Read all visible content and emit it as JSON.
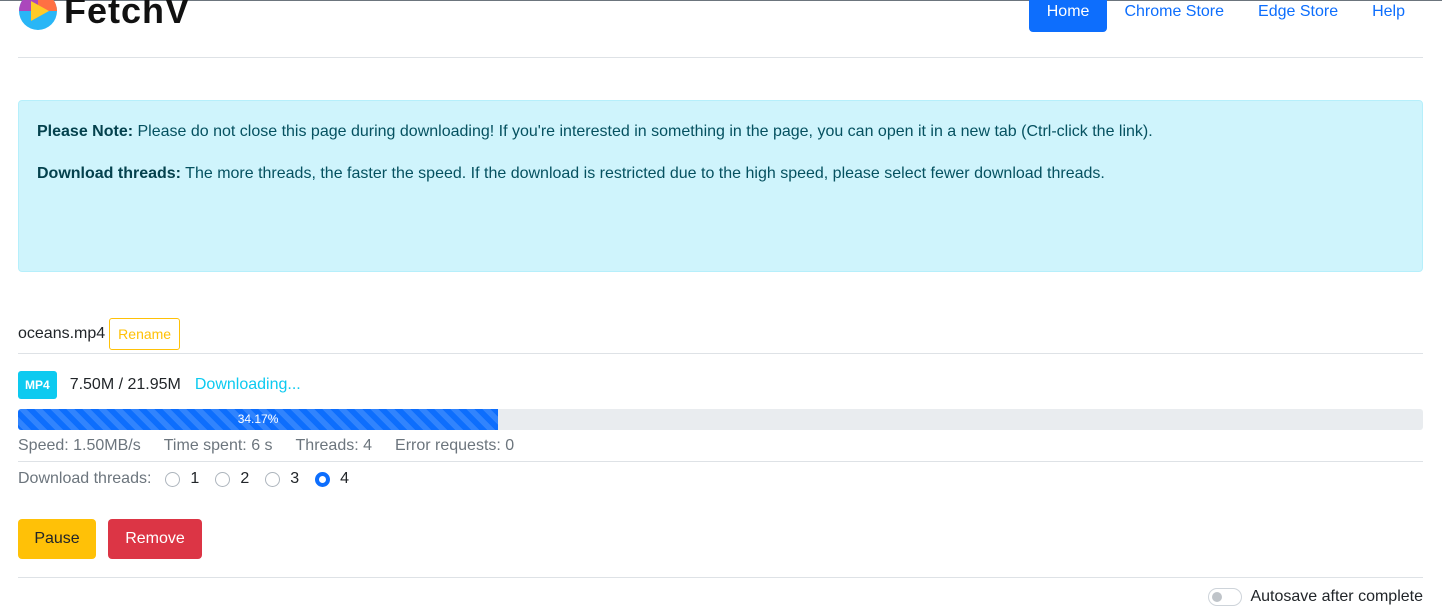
{
  "app": {
    "logo_text": "FetchV"
  },
  "nav": {
    "items": [
      {
        "label": "Home",
        "active": true
      },
      {
        "label": "Chrome Store",
        "active": false
      },
      {
        "label": "Edge Store",
        "active": false
      },
      {
        "label": "Help",
        "active": false
      }
    ]
  },
  "alert": {
    "note_title": "Please Note:",
    "note_text": " Please do not close this page during downloading! If you're interested in something in the page, you can open it in a new tab (Ctrl-click the link).",
    "threads_title": "Download threads:",
    "threads_text": " The more threads, the faster the speed. If the download is restricted due to the high speed, please select fewer download threads."
  },
  "file": {
    "name": "oceans.mp4",
    "rename_label": "Rename"
  },
  "status": {
    "format_badge": "MP4",
    "size_text": "7.50M / 21.95M",
    "state_text": "Downloading..."
  },
  "progress": {
    "percent_label": "34.17%",
    "fraction": 0.3417
  },
  "stats": {
    "speed": "Speed: 1.50MB/s",
    "time_spent": "Time spent: 6 s",
    "threads": "Threads: 4",
    "errors": "Error requests: 0"
  },
  "thread_selector": {
    "label": "Download threads:",
    "options": [
      "1",
      "2",
      "3",
      "4"
    ],
    "selected": "4"
  },
  "actions": {
    "pause_label": "Pause",
    "remove_label": "Remove"
  },
  "autosave": {
    "label": "Autosave after complete",
    "enabled": false
  },
  "colors": {
    "primary": "#0d6efd",
    "info": "#0dcaf0",
    "warning": "#ffc107",
    "danger": "#dc3545",
    "alert_bg": "#cff4fc"
  }
}
